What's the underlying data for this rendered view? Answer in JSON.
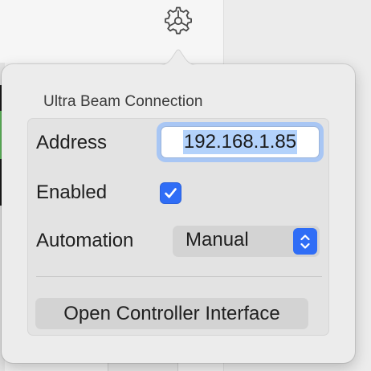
{
  "toolbar": {
    "settings_icon": "gear-icon"
  },
  "popover": {
    "title": "Ultra Beam Connection",
    "address": {
      "label": "Address",
      "value": "192.168.1.85"
    },
    "enabled": {
      "label": "Enabled",
      "checked": true
    },
    "automation": {
      "label": "Automation",
      "selected": "Manual"
    },
    "open_button_label": "Open Controller Interface"
  },
  "colors": {
    "accent": "#2f6df6",
    "focus_ring": "#a8c6f4",
    "text_selection": "#b3d2fb"
  }
}
